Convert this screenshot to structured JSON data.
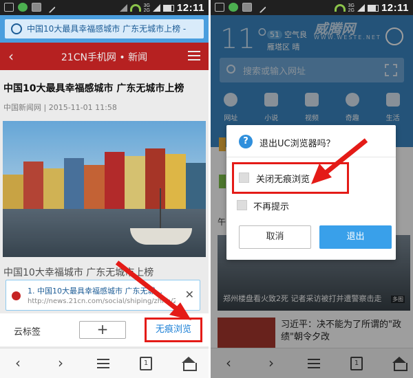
{
  "left": {
    "status": {
      "time": "12:11",
      "net_top": "3G",
      "net_bottom": "2G"
    },
    "url_bar": {
      "text": "中国10大最具幸福感城市 广东无城市上榜 -"
    },
    "site_header": {
      "back": "‹",
      "title": "21CN手机网 • 新闻"
    },
    "article": {
      "title": "中国10大最具幸福感城市 广东无城市上榜",
      "meta": "中国新闻网 | 2015-11-01 11:58",
      "next_line": "中国10大幸福城市 广东无城市上榜"
    },
    "tab_card": {
      "title": "1. 中国10大最具幸福感城市 广东无城...",
      "url": "http://news.21cn.com/social/shiping/zhnb/201...",
      "close": "✕"
    },
    "bookmark_row": {
      "cloud_label": "云标签",
      "add": "+",
      "incognito": "无痕浏览"
    },
    "navbar": {
      "back": "‹",
      "forward": "›",
      "tabs_count": "1"
    }
  },
  "right": {
    "status": {
      "time": "12:11",
      "net_top": "3G",
      "net_bottom": "2G"
    },
    "weather": {
      "temp": "11°",
      "aqi_num": "51",
      "aqi_label": "空气良",
      "location": "雁塔区  晴"
    },
    "watermark": {
      "brand": "威腾网",
      "url": "WWW.WESTE.NET"
    },
    "search": {
      "placeholder": "搜索或输入网址"
    },
    "quick_links": [
      {
        "label": "网址"
      },
      {
        "label": "小说"
      },
      {
        "label": "视频"
      },
      {
        "label": "奇趣"
      },
      {
        "label": "生活"
      }
    ],
    "section_label": "午",
    "news1": {
      "caption": "郑州楼盘看火致2死 记者采访被打并遭警察击走",
      "tag": "多图"
    },
    "news2": {
      "headline": "习近平：决不能为了所谓的\"政绩\"朝令夕改"
    },
    "dialog": {
      "title": "退出UC浏览器吗？",
      "icon_char": "?",
      "option1": "关闭无痕浏览",
      "option2": "不再提示",
      "cancel": "取消",
      "exit": "退出"
    },
    "navbar": {
      "back": "‹",
      "forward": "›",
      "tabs_count": "1"
    }
  },
  "colors": {
    "url_bar_blue": "#4a9ede",
    "site_red": "#c62424",
    "highlight_red": "#e41b17",
    "link_blue": "#1a7fd6",
    "header_blue": "#3b86c3",
    "exit_button_blue": "#39a0ea"
  }
}
